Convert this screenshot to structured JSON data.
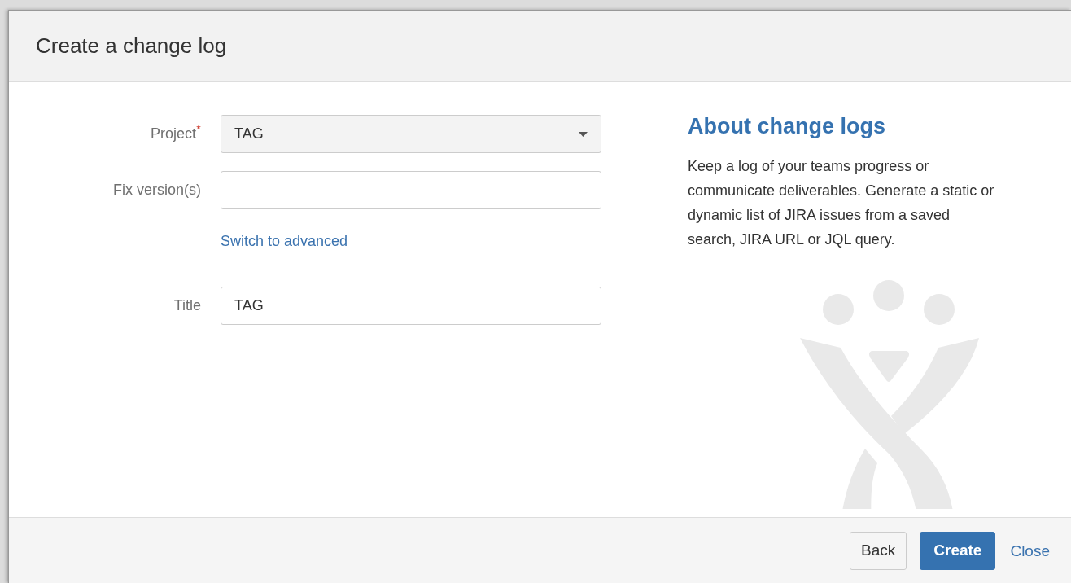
{
  "dialog": {
    "title": "Create a change log"
  },
  "form": {
    "rows": [
      {
        "kind": "select",
        "label": "Project",
        "required": true,
        "value": "TAG"
      },
      {
        "kind": "text",
        "label": "Fix version(s)"
      },
      {
        "kind": "link",
        "text": "Switch to advanced"
      },
      {
        "kind": "text",
        "label": "Title",
        "value": "TAG"
      }
    ]
  },
  "about": {
    "heading": "About change logs",
    "text": "Keep a log of your teams progress or communicate deliverables. Generate a static or dynamic list of JIRA issues from a saved search, JIRA URL or JQL query."
  },
  "footer": {
    "buttons": [
      {
        "kind": "default",
        "label": "Back"
      },
      {
        "kind": "primary",
        "label": "Create"
      },
      {
        "kind": "link",
        "label": "Close"
      }
    ]
  }
}
